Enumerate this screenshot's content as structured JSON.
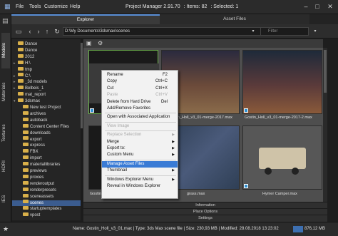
{
  "menu": [
    "File",
    "Tools",
    "Customize",
    "Help"
  ],
  "title": {
    "app": "Project Manager 2.91.70",
    "items": ": Items: 82",
    "selected": ": Selected: 1"
  },
  "tabs": [
    "Explorer",
    "Asset Files"
  ],
  "vtabs": [
    "Models",
    "Materials",
    "Textures",
    "HDRI",
    "IES"
  ],
  "path": "D:\\My Documents\\3dsmax\\scenes",
  "filter_placeholder": "Filter",
  "tree": [
    {
      "label": "Dance",
      "indent": 0,
      "exp": ""
    },
    {
      "label": "Dance",
      "indent": 0,
      "exp": ""
    },
    {
      "label": "2012",
      "indent": 0,
      "exp": ""
    },
    {
      "label": "H:\\",
      "indent": 0,
      "exp": "▸"
    },
    {
      "label": "tmp",
      "indent": 0,
      "exp": ""
    },
    {
      "label": "C:\\",
      "indent": 0,
      "exp": "▸"
    },
    {
      "label": "_3d models",
      "indent": 0,
      "exp": "▸"
    },
    {
      "label": "Belbeis_1",
      "indent": 0,
      "exp": "▸"
    },
    {
      "label": "mat_report",
      "indent": 0,
      "exp": ""
    },
    {
      "label": "3dsmax",
      "indent": 0,
      "exp": "▾"
    },
    {
      "label": "New test Project",
      "indent": 1,
      "exp": ""
    },
    {
      "label": "archives",
      "indent": 1,
      "exp": ""
    },
    {
      "label": "autoback",
      "indent": 1,
      "exp": ""
    },
    {
      "label": "Content Center Files",
      "indent": 1,
      "exp": ""
    },
    {
      "label": "downloads",
      "indent": 1,
      "exp": ""
    },
    {
      "label": "export",
      "indent": 1,
      "exp": ""
    },
    {
      "label": "express",
      "indent": 1,
      "exp": ""
    },
    {
      "label": "FBX",
      "indent": 1,
      "exp": ""
    },
    {
      "label": "import",
      "indent": 1,
      "exp": ""
    },
    {
      "label": "materiallibraries",
      "indent": 1,
      "exp": ""
    },
    {
      "label": "previews",
      "indent": 1,
      "exp": ""
    },
    {
      "label": "proxies",
      "indent": 1,
      "exp": ""
    },
    {
      "label": "renderoutput",
      "indent": 1,
      "exp": ""
    },
    {
      "label": "renderpresets",
      "indent": 1,
      "exp": ""
    },
    {
      "label": "sceneassets",
      "indent": 1,
      "exp": ""
    },
    {
      "label": "scenes",
      "indent": 1,
      "exp": "",
      "selected": true
    },
    {
      "label": "startuptemplates",
      "indent": 1,
      "exp": ""
    },
    {
      "label": "vpost",
      "indent": 1,
      "exp": ""
    }
  ],
  "thumbs": [
    {
      "caption": ""
    },
    {
      "caption": "Gostin_Holl_v3_01-merge-2017.max"
    },
    {
      "caption": "Gostin_Holl_v3_01-merge-2017-2.max"
    },
    {
      "caption": "Gostin_Holl_v3_01.max"
    },
    {
      "caption": "grass.max"
    },
    {
      "caption": "Hymer Camper.max"
    }
  ],
  "context_menu": [
    {
      "label": "Rename",
      "shortcut": "F2"
    },
    {
      "label": "Copy",
      "shortcut": "Ctrl+C"
    },
    {
      "label": "Cut",
      "shortcut": "Ctrl+X"
    },
    {
      "label": "Paste",
      "shortcut": "Ctrl+V",
      "disabled": true
    },
    {
      "label": "Delete from Hard Drive",
      "shortcut": "Del"
    },
    {
      "label": "Add/Remove Favorites",
      "shortcut": ""
    },
    {
      "sep": true
    },
    {
      "label": "Open with Associated Application",
      "shortcut": ""
    },
    {
      "sep": true
    },
    {
      "label": "View Image",
      "shortcut": "",
      "disabled": true
    },
    {
      "sep": true
    },
    {
      "label": "Replace Selection",
      "shortcut": "",
      "disabled": true,
      "arrow": true
    },
    {
      "label": "Merge",
      "shortcut": "",
      "arrow": true
    },
    {
      "label": "Export to:",
      "shortcut": "",
      "arrow": true
    },
    {
      "label": "Custom Menu",
      "shortcut": "",
      "arrow": true
    },
    {
      "sep": true
    },
    {
      "label": "Manage Asset Files",
      "shortcut": "",
      "highlighted": true
    },
    {
      "label": "Thumbnail",
      "shortcut": "",
      "arrow": true
    },
    {
      "sep": true
    },
    {
      "label": "Windows Explorer Menu",
      "shortcut": "",
      "arrow": true
    },
    {
      "label": "Reveal in Windows Explorer",
      "shortcut": ""
    }
  ],
  "rolls": [
    "Information",
    "Place Options",
    "Settings"
  ],
  "status": "Name: Gostin_Holl_v3_01.max  |  Type: 3ds Max scene file  |  Size: 230,93 MB  |  Modified: 28.08.2018 13:23:02",
  "memory": "876,12 MB",
  "colors": {
    "accent": "#3a7bd5",
    "selection": "#3b5c8f",
    "folder": "#d9b04a"
  }
}
